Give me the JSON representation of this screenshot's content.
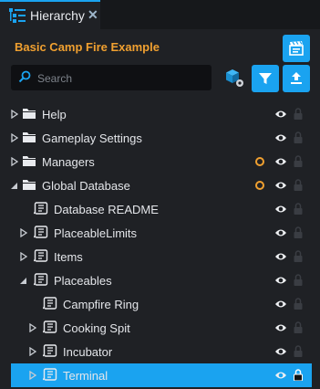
{
  "tab": {
    "label": "Hierarchy",
    "close": "✕"
  },
  "panel": {
    "title": "Basic Camp Fire Example"
  },
  "search": {
    "placeholder": "Search",
    "value": ""
  },
  "colors": {
    "accent": "#1aa3f0",
    "title": "#f0a030",
    "background": "#1f2125"
  },
  "tree": [
    {
      "label": "Help",
      "icon": "folder-icon",
      "expander": "collapsed",
      "depth": 0
    },
    {
      "label": "Gameplay Settings",
      "icon": "folder-icon",
      "expander": "collapsed",
      "depth": 0
    },
    {
      "label": "Managers",
      "icon": "folder-icon",
      "expander": "collapsed",
      "depth": 0,
      "modified": true
    },
    {
      "label": "Global Database",
      "icon": "folder-icon",
      "expander": "expanded",
      "depth": 0,
      "modified": true
    },
    {
      "label": "Database README",
      "icon": "script-icon",
      "expander": "none",
      "depth": 1
    },
    {
      "label": "PlaceableLimits",
      "icon": "script-icon",
      "expander": "collapsed",
      "depth": 1
    },
    {
      "label": "Items",
      "icon": "script-icon",
      "expander": "collapsed",
      "depth": 1
    },
    {
      "label": "Placeables",
      "icon": "script-icon",
      "expander": "expanded",
      "depth": 1
    },
    {
      "label": "Campfire Ring",
      "icon": "script-icon",
      "expander": "none",
      "depth": 2
    },
    {
      "label": "Cooking Spit",
      "icon": "script-icon",
      "expander": "collapsed",
      "depth": 2
    },
    {
      "label": "Incubator",
      "icon": "script-icon",
      "expander": "collapsed",
      "depth": 2
    },
    {
      "label": "Terminal",
      "icon": "script-icon",
      "expander": "collapsed",
      "depth": 2,
      "selected": true,
      "locked": true
    }
  ]
}
